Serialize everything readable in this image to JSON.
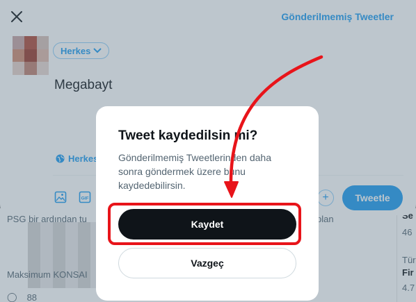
{
  "compose": {
    "drafts_link": "Gönderilmemiş Tweetler",
    "audience": "Herkes",
    "tweet_text": "Megabayt",
    "reply_setting": "Herkes",
    "tweet_button": "Tweetle"
  },
  "background_feed": {
    "line1": "PSG bir ardından tu",
    "line1_right": "plan",
    "line2": "Maksimum KONSAI",
    "reply_count": "88",
    "side1": "Se",
    "side2": "46",
    "side3": "Tür",
    "side4": "Fir",
    "side5": "4.7"
  },
  "dialog": {
    "title": "Tweet kaydedilsin mi?",
    "body": "Gönderilmemiş Tweetlerinden daha sonra göndermek üzere bunu kaydedebilirsin.",
    "save_label": "Kaydet",
    "cancel_label": "Vazgeç"
  },
  "colors": {
    "accent": "#1d9bf0",
    "annotation": "#e8141a",
    "primary_button": "#0f1419"
  }
}
